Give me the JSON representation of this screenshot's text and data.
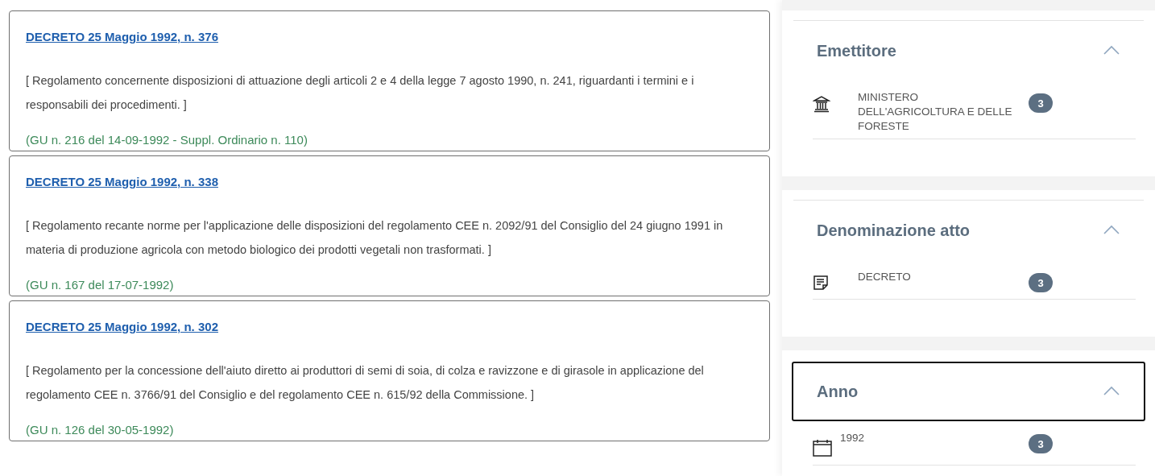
{
  "results": [
    {
      "title": "DECRETO 25 Maggio 1992, n. 376",
      "description": "[ Regolamento concernente disposizioni di attuazione degli articoli 2 e 4 della legge 7 agosto 1990, n. 241, riguardanti i termini e i responsabili dei procedimenti. ]",
      "publication": "(GU n. 216 del 14-09-1992 - Suppl. Ordinario n. 110)"
    },
    {
      "title": "DECRETO 25 Maggio 1992, n. 338",
      "description": "[ Regolamento recante norme per l'applicazione delle disposizioni del regolamento CEE n. 2092/91 del Consiglio del 24 giugno 1991 in materia di produzione agricola con metodo biologico dei prodotti vegetali non trasformati. ]",
      "publication": "(GU n. 167 del 17-07-1992)"
    },
    {
      "title": "DECRETO 25 Maggio 1992, n. 302",
      "description": "[ Regolamento per la concessione dell'aiuto diretto ai produttori di semi di soia, di colza e ravizzone e di girasole in applicazione del regolamento CEE n. 3766/91 del Consiglio e del regolamento CEE n. 615/92 della Commissione. ]",
      "publication": "(GU n. 126 del 30-05-1992)"
    }
  ],
  "filters": [
    {
      "title": "Emettitore",
      "expanded": true,
      "focused": false,
      "items": [
        {
          "kind": "institution",
          "label": "MINISTERO DELL'AGRICOLTURA E DELLE FORESTE",
          "count": "3"
        }
      ]
    },
    {
      "title": "Denominazione atto",
      "expanded": true,
      "focused": false,
      "items": [
        {
          "kind": "document",
          "label": "DECRETO",
          "count": "3"
        }
      ]
    },
    {
      "title": "Anno",
      "expanded": true,
      "focused": true,
      "items": [
        {
          "kind": "year",
          "label": "1992",
          "count": "3"
        }
      ]
    }
  ]
}
